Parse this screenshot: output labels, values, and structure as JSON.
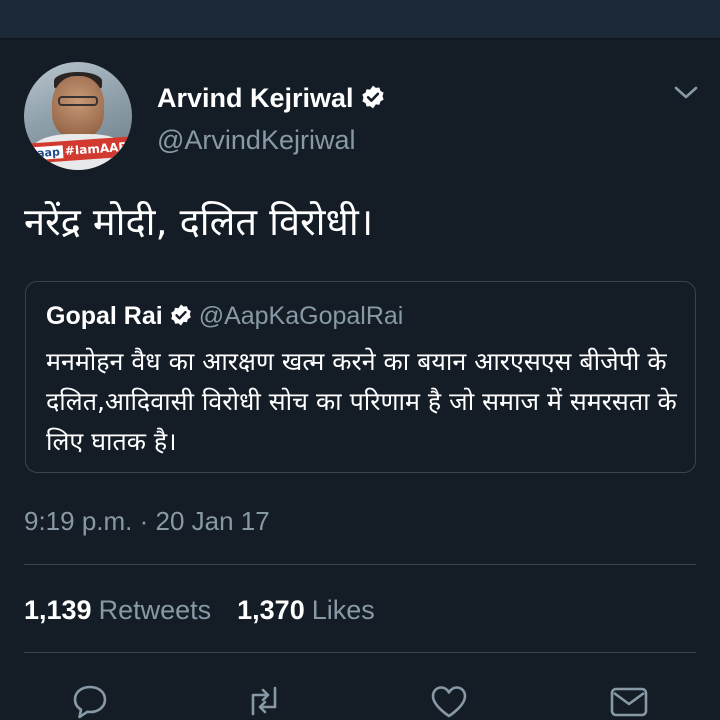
{
  "app_bar": {
    "label": ""
  },
  "author": {
    "name": "Arvind Kejriwal",
    "handle": "@ArvindKejriwal",
    "avatar_banner_brand": "aap",
    "avatar_banner_text": "#IamAAP",
    "verified_icon": "verified-badge-icon",
    "menu_icon": "chevron-down-icon"
  },
  "tweet": {
    "text": "नरेंद्र मोदी, दलित विरोधी।"
  },
  "quoted_tweet": {
    "name": "Gopal Rai",
    "handle": "@AapKaGopalRai",
    "text": "मनमोहन वैध का आरक्षण खत्म करने का बयान आरएसएस बीजेपी के दलित,आदिवासी विरोधी सोच का परिणाम है जो समाज में समरसता के लिए घातक है।"
  },
  "timestamp": "9:19 p.m. · 20 Jan 17",
  "stats": {
    "retweets_count": "1,139",
    "retweets_label": "Retweets",
    "likes_count": "1,370",
    "likes_label": "Likes"
  },
  "actions": [
    {
      "name": "reply",
      "icon": "reply-icon"
    },
    {
      "name": "retweet",
      "icon": "retweet-icon"
    },
    {
      "name": "like",
      "icon": "heart-icon"
    },
    {
      "name": "direct-message",
      "icon": "mail-icon"
    }
  ],
  "colors": {
    "background": "#141d26",
    "top_bar": "#1b2836",
    "primary_text": "#ffffff",
    "secondary_text": "#8899a6",
    "border": "#38444d",
    "verified_badge": "#ffffff"
  }
}
